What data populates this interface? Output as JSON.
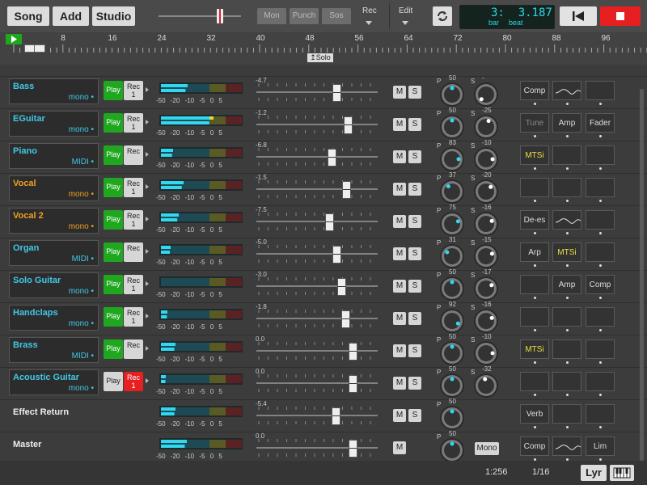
{
  "toolbar": {
    "song": "Song",
    "add": "Add",
    "studio": "Studio",
    "mon": "Mon",
    "punch": "Punch",
    "sos": "Sos",
    "rec": "Rec",
    "edit": "Edit",
    "lcd_main": "3:  3.187",
    "lcd_bar": "bar",
    "lcd_beat": "beat"
  },
  "ruler": {
    "marks": [
      "8",
      "16",
      "24",
      "32",
      "40",
      "48",
      "56",
      "64",
      "72",
      "80",
      "88",
      "96"
    ],
    "solo_marker": "↥Solo"
  },
  "meter_scale": "-50 -20 -10 -5 0 5",
  "tracks": [
    {
      "name": "Bass",
      "sub": "mono",
      "color": "#41c8e6",
      "play": "Play",
      "play_on": true,
      "rec": "Rec",
      "rec_num": "1",
      "rec_on": false,
      "fader_val": "-4.7",
      "fader": 0.66,
      "meter": 0.33,
      "pan": "50",
      "send": "-",
      "fx": [
        "Comp",
        "~",
        ""
      ]
    },
    {
      "name": "EGuitar",
      "sub": "mono",
      "color": "#41c8e6",
      "play": "Play",
      "play_on": true,
      "rec": "Rec",
      "rec_num": "1",
      "rec_on": false,
      "fader_val": "-1.2",
      "fader": 0.75,
      "meter": 0.65,
      "pan": "50",
      "send": "-25",
      "fx": [
        "Tune",
        "Amp",
        "Fader"
      ]
    },
    {
      "name": "Piano",
      "sub": "MIDI",
      "color": "#41c8e6",
      "play": "Play",
      "play_on": true,
      "rec": "Rec",
      "rec_num": "",
      "rec_on": false,
      "fader_val": "-6.8",
      "fader": 0.62,
      "meter": 0.15,
      "pan": "83",
      "send": "-10",
      "fx": [
        "MTSi",
        "",
        ""
      ]
    },
    {
      "name": "Vocal",
      "sub": "mono",
      "color": "#f0a020",
      "play": "Play",
      "play_on": true,
      "rec": "Rec",
      "rec_num": "1",
      "rec_on": false,
      "fader_val": "-1.5",
      "fader": 0.74,
      "meter": 0.28,
      "pan": "37",
      "send": "-20",
      "fx": [
        "",
        "",
        ""
      ]
    },
    {
      "name": "Vocal 2",
      "sub": "mono",
      "color": "#f0a020",
      "play": "Play",
      "play_on": true,
      "rec": "Rec",
      "rec_num": "1",
      "rec_on": false,
      "fader_val": "-7.5",
      "fader": 0.6,
      "meter": 0.22,
      "pan": "75",
      "send": "-16",
      "fx": [
        "De-es",
        "~",
        ""
      ]
    },
    {
      "name": "Organ",
      "sub": "MIDI",
      "color": "#41c8e6",
      "play": "Play",
      "play_on": true,
      "rec": "Rec",
      "rec_num": "",
      "rec_on": false,
      "fader_val": "-5.0",
      "fader": 0.66,
      "meter": 0.12,
      "pan": "31",
      "send": "-15",
      "fx": [
        "Arp",
        "MTSi",
        ""
      ]
    },
    {
      "name": "Solo Guitar",
      "sub": "mono",
      "color": "#41c8e6",
      "play": "Play",
      "play_on": true,
      "rec": "Rec",
      "rec_num": "1",
      "rec_on": false,
      "fader_val": "-3.0",
      "fader": 0.7,
      "meter": 0.0,
      "pan": "50",
      "send": "-17",
      "fx": [
        "",
        "Amp",
        "Comp"
      ]
    },
    {
      "name": "Handclaps",
      "sub": "mono",
      "color": "#41c8e6",
      "play": "Play",
      "play_on": true,
      "rec": "Rec",
      "rec_num": "1",
      "rec_on": false,
      "fader_val": "-1.8",
      "fader": 0.73,
      "meter": 0.08,
      "pan": "92",
      "send": "-16",
      "fx": [
        "",
        "",
        ""
      ]
    },
    {
      "name": "Brass",
      "sub": "MIDI",
      "color": "#41c8e6",
      "play": "Play",
      "play_on": true,
      "rec": "Rec",
      "rec_num": "",
      "rec_on": false,
      "fader_val": "0.0",
      "fader": 0.79,
      "meter": 0.18,
      "pan": "50",
      "send": "-10",
      "fx": [
        "MTSi",
        "",
        ""
      ]
    },
    {
      "name": "Acoustic Guitar",
      "sub": "mono",
      "color": "#41c8e6",
      "play": "Play",
      "play_on": false,
      "rec": "Rec",
      "rec_num": "1",
      "rec_on": true,
      "fader_val": "0.0",
      "fader": 0.79,
      "meter": 0.06,
      "pan": "50",
      "send": "-32",
      "fx": [
        "",
        "",
        ""
      ]
    }
  ],
  "effect_return": {
    "name": "Effect Return",
    "fader_val": "-5.4",
    "fader": 0.65,
    "meter": 0.18,
    "pan": "50",
    "fx": [
      "Verb",
      "",
      ""
    ]
  },
  "master": {
    "name": "Master",
    "fader_val": "0.0",
    "fader": 0.79,
    "meter": 0.32,
    "pan": "50",
    "mono": "Mono",
    "fx": [
      "Comp",
      "~",
      "Lim"
    ]
  },
  "buttons": {
    "m": "M",
    "s": "S",
    "p": "P"
  },
  "status": {
    "ratio": "1:256",
    "grid": "1/16",
    "lyr": "Lyr"
  },
  "colors": {
    "cyan": "#41c8e6",
    "orange": "#f0a020",
    "green": "#1fa81f",
    "red": "#e62020"
  }
}
